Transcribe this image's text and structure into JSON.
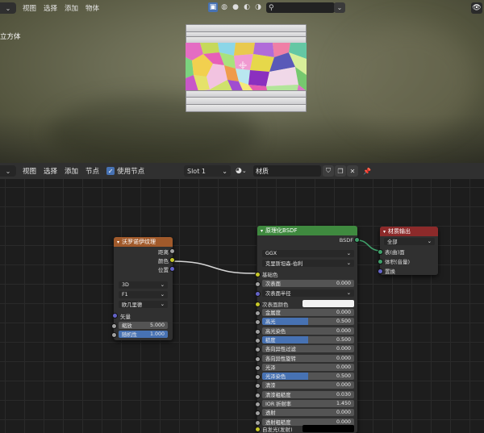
{
  "viewport": {
    "menu": [
      "视图",
      "选择",
      "添加",
      "物体"
    ],
    "object_label": "立方体",
    "shading_icons": [
      "cube-select-icon",
      "wireframe-sphere-icon",
      "solid-sphere-icon",
      "material-sphere-icon",
      "rendered-sphere-icon",
      "transform-icon",
      "search-icon"
    ],
    "search_value": "",
    "right_icon": "eye-icon"
  },
  "editor": {
    "menu": [
      "视图",
      "选择",
      "添加",
      "节点"
    ],
    "use_nodes_label": "使用节点",
    "use_nodes_checked": true,
    "slot": "Slot 1",
    "material_name": "材质"
  },
  "nodes": {
    "voronoi": {
      "title": "沃罗诺伊纹理",
      "outputs": [
        "距离",
        "颜色",
        "位置"
      ],
      "dims": "3D",
      "feature": "F1",
      "metric": "欧几里德",
      "vector_label": "矢量",
      "scale_label": "缩放",
      "scale_value": "5.000",
      "random_label": "随机性",
      "random_value": "1.000",
      "random_fill": 1.0
    },
    "bsdf": {
      "title": "原理化BSDF",
      "output": "BSDF",
      "distribution": "GGX",
      "subsurface_method": "克里斯坦森-伯利",
      "base_color_label": "基础色",
      "sss_label": "次表面",
      "sss_value": "0.000",
      "sss_radius_label": "次表面半径",
      "sss_color_label": "次表面颜色",
      "rows": [
        {
          "label": "金属度",
          "value": "0.000",
          "fill": 0
        },
        {
          "label": "高光",
          "value": "0.500",
          "fill": 0.5
        },
        {
          "label": "高光染色",
          "value": "0.000",
          "fill": 0
        },
        {
          "label": "糙度",
          "value": "0.500",
          "fill": 0.5
        },
        {
          "label": "各向异性过滤",
          "value": "0.000",
          "fill": 0
        },
        {
          "label": "各向异性旋转",
          "value": "0.000",
          "fill": 0
        },
        {
          "label": "光泽",
          "value": "0.000",
          "fill": 0
        },
        {
          "label": "光泽染色",
          "value": "0.500",
          "fill": 0.5
        },
        {
          "label": "清漆",
          "value": "0.000",
          "fill": 0
        },
        {
          "label": "清漆粗糙度",
          "value": "0.030",
          "fill": 0.03
        },
        {
          "label": "IOR 折射率",
          "value": "1.450",
          "fill": 0
        },
        {
          "label": "透射",
          "value": "0.000",
          "fill": 0
        },
        {
          "label": "透射粗糙度",
          "value": "0.000",
          "fill": 0
        }
      ],
      "emission_label": "自发光(发射)"
    },
    "output": {
      "title": "材质输出",
      "target": "全部",
      "inputs": [
        "表(曲)面",
        "体积(音量)",
        "置换"
      ]
    }
  },
  "colors": {
    "voronoi_header": "#a15a2b",
    "bsdf_header": "#3f8a3f",
    "output_header": "#8c2a2a",
    "accent": "#4772b3"
  }
}
